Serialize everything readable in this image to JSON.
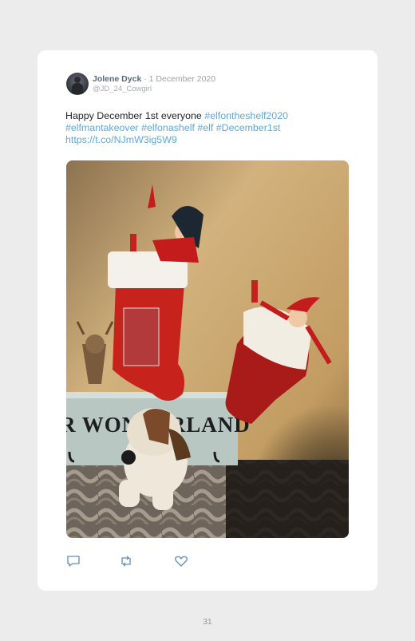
{
  "tweet": {
    "author_name": "Jolene Dyck",
    "separator": " · ",
    "date": "1 December 2020",
    "handle": "@JD_24_Cowgirl",
    "text_plain": "Happy December 1st everyone ",
    "hashtag_1": "#elfontheshelf2020",
    "hashtag_2": "#elfmantakeover",
    "hashtag_3": "#elfonashelf",
    "hashtag_4": "#elf",
    "hashtag_5": "#December1st",
    "link": "https://t.co/NJmW3ig5W9",
    "photo_sign_text": "R WONDERLAND"
  },
  "icons": {
    "reply": "reply-icon",
    "retweet": "retweet-icon",
    "like": "heart-icon"
  },
  "colors": {
    "link": "#5fa9e0",
    "author": "#5a6a7c",
    "page_bg": "#ececec"
  },
  "page": {
    "number": "31"
  }
}
